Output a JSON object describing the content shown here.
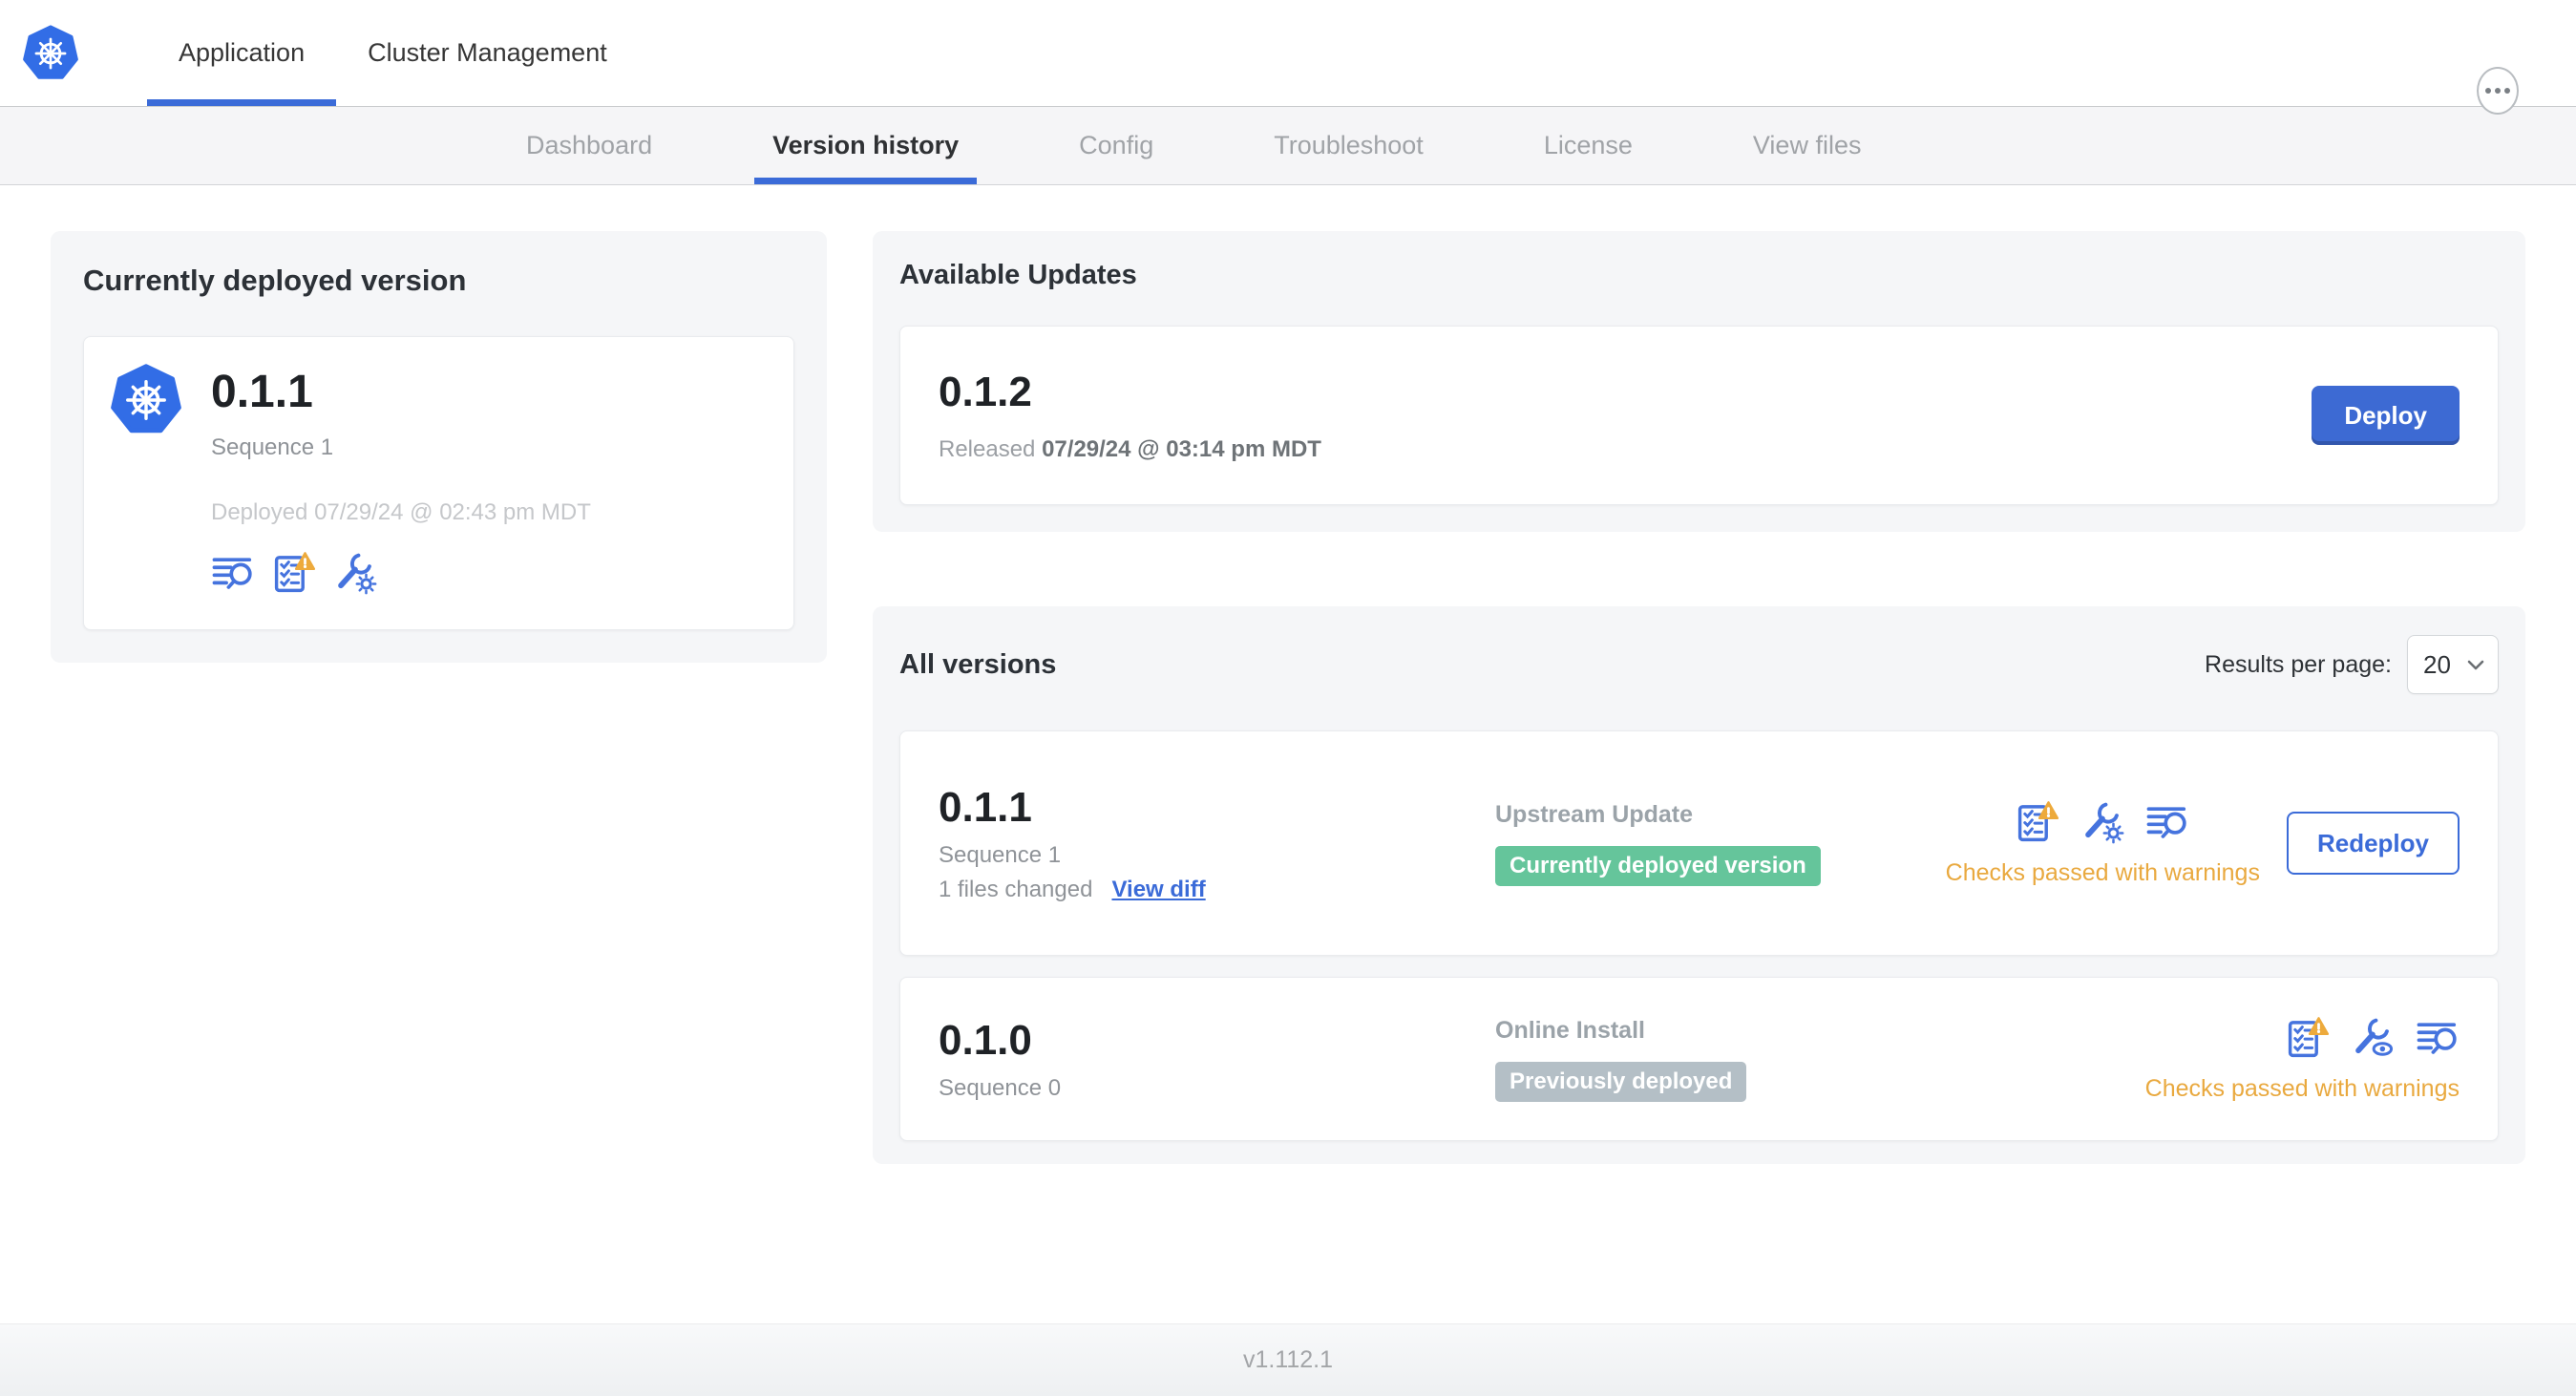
{
  "colors": {
    "accent_blue": "#3b6bd8",
    "k8s_logo_blue": "#326de6",
    "badge_green": "#65c59b",
    "badge_gray": "#b4bfc6",
    "warning_orange": "#e9a93f",
    "panel_gray": "#f5f6f8"
  },
  "navbar": {
    "logo_icon": "kubernetes-logo-icon",
    "tabs": [
      {
        "label": "Application",
        "active": true
      },
      {
        "label": "Cluster Management",
        "active": false
      }
    ],
    "more_icon": "ellipsis-icon"
  },
  "subnav": {
    "tabs": [
      {
        "label": "Dashboard",
        "active": false
      },
      {
        "label": "Version history",
        "active": true
      },
      {
        "label": "Config",
        "active": false
      },
      {
        "label": "Troubleshoot",
        "active": false
      },
      {
        "label": "License",
        "active": false
      },
      {
        "label": "View files",
        "active": false
      }
    ]
  },
  "current_version": {
    "title": "Currently deployed version",
    "version": "0.1.1",
    "sequence": "Sequence 1",
    "deployed": "Deployed 07/29/24 @ 02:43 pm MDT",
    "icons": [
      "release-notes-icon",
      "preflight-checks-warning-icon",
      "edit-config-icon"
    ]
  },
  "available_updates": {
    "title": "Available Updates",
    "version": "0.1.2",
    "released_prefix": "Released",
    "released_date": "07/29/24 @ 03:14 pm MDT",
    "deploy_label": "Deploy"
  },
  "all_versions": {
    "title": "All versions",
    "results_per_page_label": "Results per page:",
    "results_per_page_value": "20",
    "rows": [
      {
        "version": "0.1.1",
        "sequence": "Sequence 1",
        "files_changed": "1 files changed",
        "view_diff_label": "View diff",
        "source": "Upstream Update",
        "badge": "Currently deployed version",
        "badge_color": "green",
        "icons": [
          "preflight-checks-warning-icon",
          "edit-config-icon",
          "release-notes-icon"
        ],
        "checks_status": "Checks passed with warnings",
        "action_label": "Redeploy"
      },
      {
        "version": "0.1.0",
        "sequence": "Sequence 0",
        "source": "Online Install",
        "badge": "Previously deployed",
        "badge_color": "gray",
        "icons": [
          "preflight-checks-warning-icon",
          "view-config-icon",
          "release-notes-icon"
        ],
        "checks_status": "Checks passed with warnings"
      }
    ]
  },
  "footer": {
    "app_version": "v1.112.1"
  }
}
